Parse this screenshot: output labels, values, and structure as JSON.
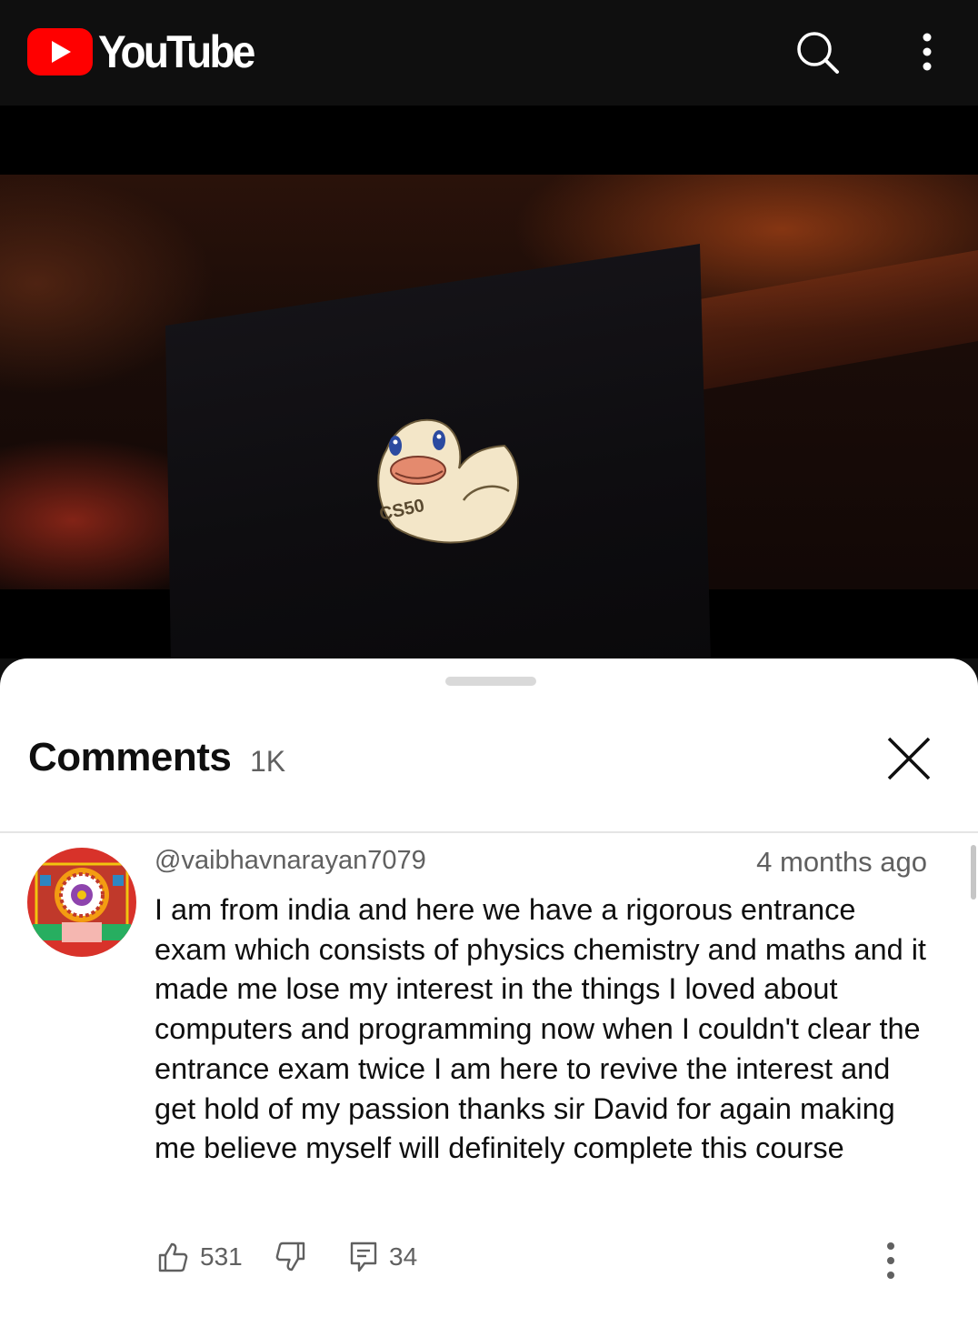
{
  "header": {
    "app_name": "YouTube"
  },
  "video": {
    "sticker_text": "CS50"
  },
  "comments_panel": {
    "title": "Comments",
    "count": "1K"
  },
  "comment": {
    "author": "@vaibhavnarayan7079",
    "time": "4 months ago",
    "text": "I am from india and here we have a rigorous entrance exam which consists of physics chemistry and maths and it made me lose my interest in the things I loved about computers and programming now when I couldn't clear the entrance exam twice I am here to revive the interest and get hold of my passion  thanks sir David for again making me believe myself will definitely complete this course",
    "likes": "531",
    "replies": "34"
  },
  "colors": {
    "brand_red": "#ff0000",
    "header_bg": "#0f0f0f",
    "secondary_text": "#606060"
  },
  "icons": [
    "youtube-logo-icon",
    "search-icon",
    "more-vert-icon",
    "close-icon",
    "thumbs-up-icon",
    "thumbs-down-icon",
    "reply-icon",
    "comment-more-icon"
  ]
}
